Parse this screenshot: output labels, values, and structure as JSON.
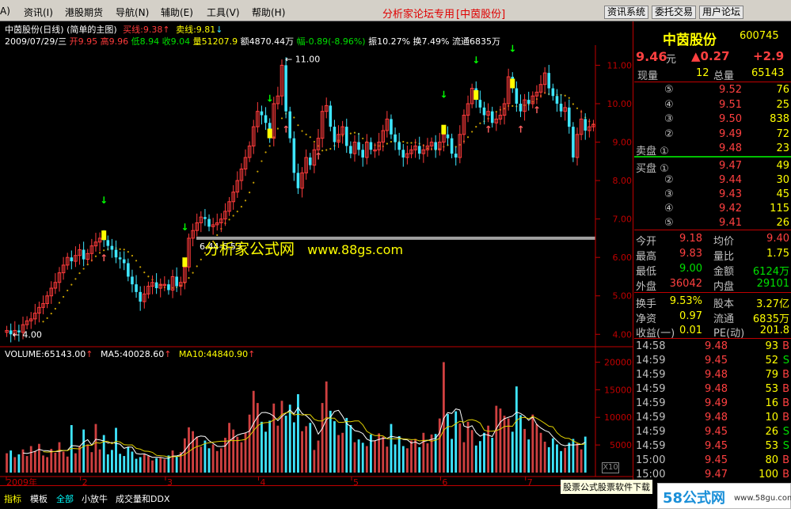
{
  "menu": {
    "items": [
      "A)",
      "资讯(I)",
      "港股期货",
      "导航(N)",
      "辅助(E)",
      "工具(V)",
      "帮助(H)"
    ],
    "forum": "分析家论坛专用",
    "stock_tag": "[中茵股份]",
    "buttons": [
      "资讯系统",
      "委托交易",
      "用户论坛"
    ]
  },
  "chart_header": {
    "title": "中茵股份(日线) (简单的主图)",
    "buy_line": "买线:9.38",
    "sell_line": "卖线:9.81",
    "ohlc": {
      "date": "2009/07/29/三",
      "open": "开9.95",
      "high": "高9.96",
      "low": "低8.94",
      "close": "收9.04",
      "volume": "量51207.9",
      "amount": "额4870.44万",
      "change": "幅-0.89(-8.96%)",
      "amplitude": "振10.27%",
      "turnover": "换7.49%",
      "float": "流通6835万"
    }
  },
  "annotations": {
    "high": "11.00",
    "low": "4.00",
    "range": "6.44-6.53"
  },
  "watermark": {
    "site": "分析家公式网",
    "url": "www.88gs.com"
  },
  "volume_header": {
    "volume": "VOLUME:65143.00",
    "ma5": "MA5:40028.60",
    "ma10": "MA10:44840.90"
  },
  "x_axis": {
    "labels": [
      "2009年",
      "2",
      "3",
      "4",
      "5",
      "6",
      "7"
    ]
  },
  "x10": "X10",
  "colors": {
    "up": "#ff3b3b",
    "down": "#3ee6ff",
    "ma": "#c8a000",
    "yellow": "#ffff00",
    "white": "#ffffff"
  },
  "chart_data": {
    "type": "candlestick",
    "price_axis": {
      "ticks": [
        4.0,
        5.0,
        6.0,
        7.0,
        8.0,
        9.0,
        10.0,
        11.0
      ],
      "range": [
        3.8,
        11.4
      ]
    },
    "volume_axis": {
      "ticks": [
        5000,
        10000,
        15000,
        20000
      ],
      "range": [
        0,
        21500
      ]
    },
    "closes": [
      4.1,
      4.0,
      4.1,
      4.05,
      4.25,
      4.35,
      4.4,
      4.55,
      4.7,
      4.8,
      5.0,
      5.2,
      5.35,
      5.6,
      5.8,
      6.0,
      5.9,
      6.05,
      6.2,
      5.95,
      6.1,
      6.3,
      6.4,
      6.5,
      6.45,
      6.3,
      6.2,
      6.0,
      5.95,
      5.85,
      5.5,
      5.3,
      5.1,
      4.85,
      5.05,
      5.25,
      5.35,
      5.2,
      5.3,
      5.3,
      5.15,
      5.5,
      5.25,
      5.35,
      5.75,
      6.5,
      6.7,
      6.9,
      7.05,
      7.0,
      6.8,
      6.85,
      6.9,
      7.0,
      7.2,
      7.45,
      7.7,
      8.0,
      8.3,
      8.6,
      8.9,
      9.4,
      9.8,
      9.7,
      9.5,
      9.1,
      10.0,
      10.2,
      11.0,
      9.8,
      9.1,
      8.2,
      7.8,
      8.2,
      8.6,
      8.4,
      8.8,
      9.1,
      9.8,
      9.95,
      9.4,
      9.0,
      9.2,
      9.4,
      8.9,
      8.7,
      9.0,
      8.8,
      8.6,
      9.0,
      8.8,
      8.8,
      9.0,
      9.3,
      9.6,
      9.2,
      9.0,
      8.8,
      8.6,
      8.7,
      8.8,
      8.9,
      8.7,
      8.8,
      8.9,
      9.0,
      8.8,
      9.0,
      9.2,
      9.1,
      8.7,
      8.6,
      9.2,
      9.7,
      10.0,
      10.4,
      10.1,
      9.9,
      9.7,
      9.8,
      9.5,
      9.6,
      9.7,
      10.0,
      10.7,
      10.4,
      10.0,
      9.8,
      10.1,
      10.0,
      10.2,
      10.3,
      10.5,
      10.8,
      10.4,
      10.2,
      10.0,
      9.8,
      9.9,
      9.4,
      8.6,
      9.2,
      9.6,
      9.3,
      9.4,
      9.46
    ],
    "volumes": [
      3500,
      4000,
      2800,
      3300,
      4200,
      3000,
      4800,
      3900,
      5200,
      3100,
      2800,
      4300,
      3600,
      5500,
      3800,
      2900,
      8600,
      3500,
      4800,
      7800,
      5100,
      3700,
      8800,
      4200,
      6800,
      3300,
      4100,
      8100,
      3400,
      3000,
      4600,
      3800,
      2500,
      2800,
      3300,
      3000,
      2200,
      2600,
      2700,
      2400,
      3100,
      4000,
      2900,
      3700,
      6200,
      8200,
      7500,
      6500,
      4700,
      5800,
      4400,
      5100,
      3900,
      4400,
      6300,
      9000,
      7800,
      6500,
      5500,
      7200,
      10500,
      14800,
      12600,
      9200,
      7400,
      9400,
      12500,
      8500,
      13000,
      10300,
      12300,
      9100,
      14200,
      7500,
      8400,
      9000,
      4100,
      5800,
      12600,
      16500,
      11200,
      9300,
      6800,
      7200,
      9900,
      8600,
      5500,
      6000,
      5400,
      4800,
      6900,
      5800,
      7100,
      6500,
      4700,
      8800,
      5100,
      6600,
      4800,
      4400,
      5800,
      6100,
      4600,
      7200,
      5300,
      6900,
      7000,
      9800,
      20000,
      10600,
      6100,
      11100,
      8900,
      5500,
      9200,
      7700,
      4900,
      5700,
      7200,
      8500,
      6300,
      12100,
      11600,
      10300,
      9800,
      7400,
      15600,
      10400,
      7900,
      6000,
      10500,
      8800,
      7200,
      5600,
      4600,
      6200,
      5100,
      3900,
      4500,
      5400,
      6100,
      5300,
      4200,
      6514
    ],
    "buy_markers": [
      24,
      44,
      65,
      108,
      116,
      125
    ],
    "sell_markers": [
      24,
      69,
      77,
      119,
      127,
      131
    ]
  },
  "panel": {
    "name": "中茵股份",
    "code": "600745",
    "price": "9.46",
    "price_unit": "元",
    "change": "▲0.27",
    "change_pct": "+2.9",
    "vol_now_label": "现量",
    "vol_now": "12",
    "vol_total_label": "总量",
    "vol_total": "65143",
    "asks": [
      {
        "lv": "⑤",
        "p": "9.52",
        "v": "76"
      },
      {
        "lv": "④",
        "p": "9.51",
        "v": "25"
      },
      {
        "lv": "③",
        "p": "9.50",
        "v": "838"
      },
      {
        "lv": "②",
        "p": "9.49",
        "v": "72"
      },
      {
        "lv": "卖盘 ①",
        "p": "9.48",
        "v": "23"
      }
    ],
    "bids": [
      {
        "lv": "买盘 ①",
        "p": "9.47",
        "v": "49"
      },
      {
        "lv": "②",
        "p": "9.44",
        "v": "30"
      },
      {
        "lv": "③",
        "p": "9.43",
        "v": "45"
      },
      {
        "lv": "④",
        "p": "9.42",
        "v": "115"
      },
      {
        "lv": "⑤",
        "p": "9.41",
        "v": "26"
      }
    ],
    "stats": [
      [
        "今开",
        "9.18",
        "均价",
        "9.40"
      ],
      [
        "最高",
        "9.83",
        "量比",
        "1.75"
      ],
      [
        "最低",
        "9.00",
        "金额",
        "6124万"
      ],
      [
        "外盘",
        "36042",
        "内盘",
        "29101"
      ]
    ],
    "fund": [
      [
        "换手",
        "9.53%",
        "股本",
        "3.27亿"
      ],
      [
        "净资",
        "0.97",
        "流通",
        "6835万"
      ],
      [
        "收益(一)",
        "0.01",
        "PE(动)",
        "201.8"
      ]
    ],
    "ticks": [
      [
        "14:58",
        "9.48",
        "93",
        "B"
      ],
      [
        "14:59",
        "9.45",
        "52",
        "S"
      ],
      [
        "14:59",
        "9.48",
        "79",
        "B"
      ],
      [
        "14:59",
        "9.48",
        "53",
        "B"
      ],
      [
        "14:59",
        "9.49",
        "16",
        "B"
      ],
      [
        "14:59",
        "9.48",
        "10",
        "B"
      ],
      [
        "14:59",
        "9.45",
        "26",
        "S"
      ],
      [
        "14:59",
        "9.45",
        "53",
        "S"
      ],
      [
        "15:00",
        "9.45",
        "80",
        "B"
      ],
      [
        "15:00",
        "9.47",
        "100",
        "B"
      ]
    ]
  },
  "tabs": [
    "指标",
    "模板",
    "全部",
    "小放牛",
    "成交量和DDX"
  ],
  "ad": "股票公式股票软件下载",
  "logo": {
    "brand": "58公式网",
    "url": "www.58gu.com"
  }
}
